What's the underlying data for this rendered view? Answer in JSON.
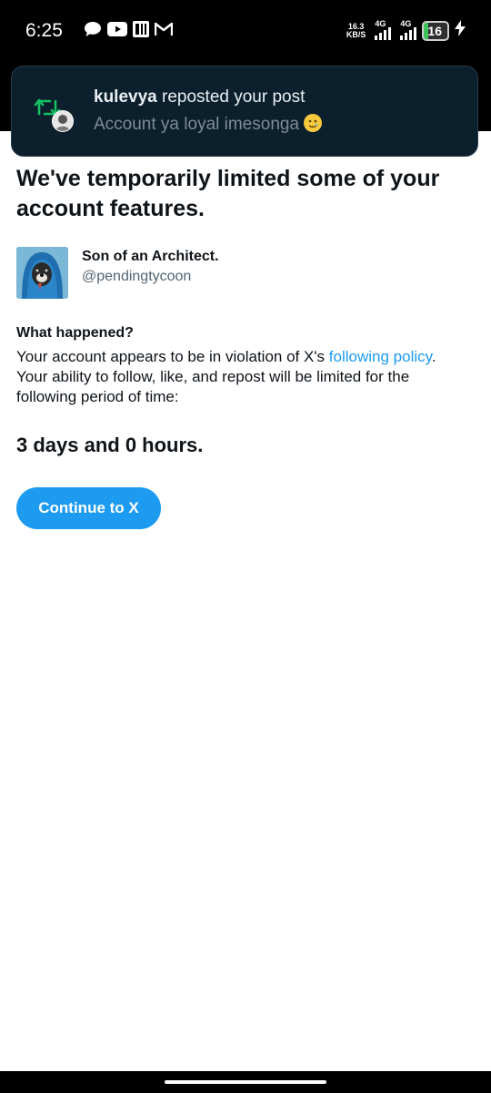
{
  "status_bar": {
    "time": "6:25",
    "left_icons": [
      "chat-bubble-icon",
      "youtube-icon",
      "app-icon",
      "gmail-icon"
    ],
    "net_speed_value": "16.3",
    "net_speed_unit": "KB/S",
    "sim1_label": "4G",
    "sim2_label": "4G",
    "battery_level": "16",
    "charging": true
  },
  "notification": {
    "user": "kulevya",
    "action": " reposted your post",
    "text": "Account ya loyal imesonga",
    "icon": "repost-icon",
    "accent_color": "#17bf63"
  },
  "main": {
    "heading": "We've temporarily limited some of your account features.",
    "profile": {
      "name": "Son of an Architect.",
      "handle": "@pendingtycoon"
    },
    "what_happened_title": "What happened?",
    "body_before_link": "Your account appears to be in violation of X's ",
    "link_text": "following policy",
    "body_after_link": ". Your ability to follow, like, and repost will be limited for the following period of time:",
    "duration": "3 days and 0 hours.",
    "continue_label": "Continue to X"
  },
  "colors": {
    "accent": "#1d9bf0",
    "text": "#0f1419",
    "secondary_text": "#536471"
  }
}
